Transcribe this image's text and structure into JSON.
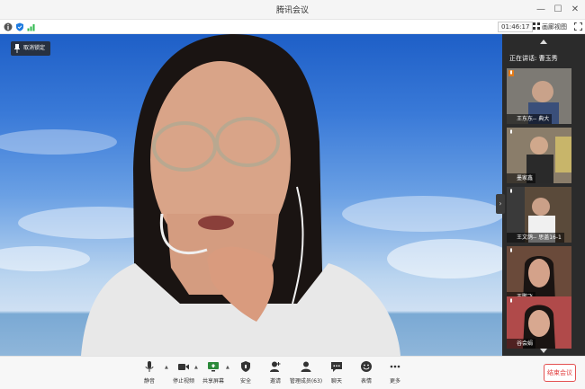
{
  "window": {
    "title": "腾讯会议"
  },
  "status": {
    "timer": "01:46:17",
    "gallery_label": "画廊视图"
  },
  "main": {
    "unpin_label": "取消锁定"
  },
  "side": {
    "speaking_label": "正在讲话: 曹玉秀",
    "participants": [
      {
        "name": "王东东-- 典大"
      },
      {
        "name": "墨家鑫"
      },
      {
        "name": "王文鸽-- 思盖16-1"
      },
      {
        "name": "王鹏飞"
      },
      {
        "name": "谷会娟"
      }
    ]
  },
  "toolbar": {
    "mute": "静音",
    "stop_video": "停止视频",
    "share_screen": "共享屏幕",
    "security": "安全",
    "invite": "邀请",
    "members": "管理成员(63)",
    "chat": "聊天",
    "reactions": "表情",
    "more": "更多",
    "end_meeting": "结束会议"
  },
  "colors": {
    "end_button": "#e03c3c",
    "toolbar_bg": "#f7f7f7",
    "side_bg": "#2b2b2b"
  }
}
